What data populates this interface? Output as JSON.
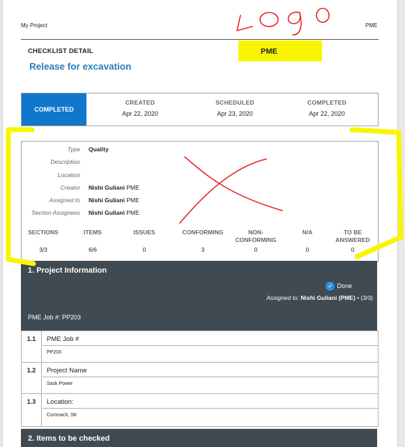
{
  "header": {
    "project": "My Project",
    "company": "PME",
    "checklist_label": "CHECKLIST DETAIL",
    "highlight_label": "PME",
    "title": "Release for excavation"
  },
  "status": {
    "state": "COMPLETED",
    "columns": [
      {
        "label": "CREATED",
        "value": "Apr 22, 2020"
      },
      {
        "label": "SCHEDULED",
        "value": "Apr 23, 2020"
      },
      {
        "label": "COMPLETED",
        "value": "Apr 22, 2020"
      }
    ]
  },
  "details": {
    "type_label": "Type",
    "type_value": "Quality",
    "description_label": "Description",
    "location_label": "Location",
    "creator_label": "Creator",
    "creator_name": "Nishi Guliani",
    "creator_company": "PME",
    "assigned_label": "Assigned to",
    "assigned_name": "Nishi Guliani",
    "assigned_company": "PME",
    "section_assignees_label": "Section Assignees",
    "section_assignees_name": "Nishi Guliani",
    "section_assignees_company": "PME"
  },
  "stats": [
    {
      "label": "SECTIONS",
      "value": "3/3"
    },
    {
      "label": "ITEMS",
      "value": "6/6"
    },
    {
      "label": "ISSUES",
      "value": "0"
    },
    {
      "label": "CONFORMING",
      "value": "3"
    },
    {
      "label": "NON-\nCONFORMING",
      "value": "0"
    },
    {
      "label": "N/A",
      "value": "0"
    },
    {
      "label": "TO BE\nANSWERED",
      "value": "0"
    }
  ],
  "section1": {
    "title": "1. Project Information",
    "done_label": "Done",
    "assigned_prefix": "Assigned to:",
    "assigned_value": "Nishi Guliani (PME)",
    "assigned_suffix": "• (3/3)",
    "job_line": "PME Job #: PP203",
    "items": [
      {
        "num": "1.1",
        "question": "PME Job #",
        "answer": "PP203"
      },
      {
        "num": "1.2",
        "question": "Project Name",
        "answer": "Sask Power"
      },
      {
        "num": "1.3",
        "question": "Location:",
        "answer": "Coronach, SK"
      }
    ]
  },
  "section2": {
    "title": "2. Items to be checked"
  },
  "annotations": {
    "logo_handwriting": "Logo",
    "highlight_color": "#f7f500",
    "ink_color": "#e8231e"
  }
}
